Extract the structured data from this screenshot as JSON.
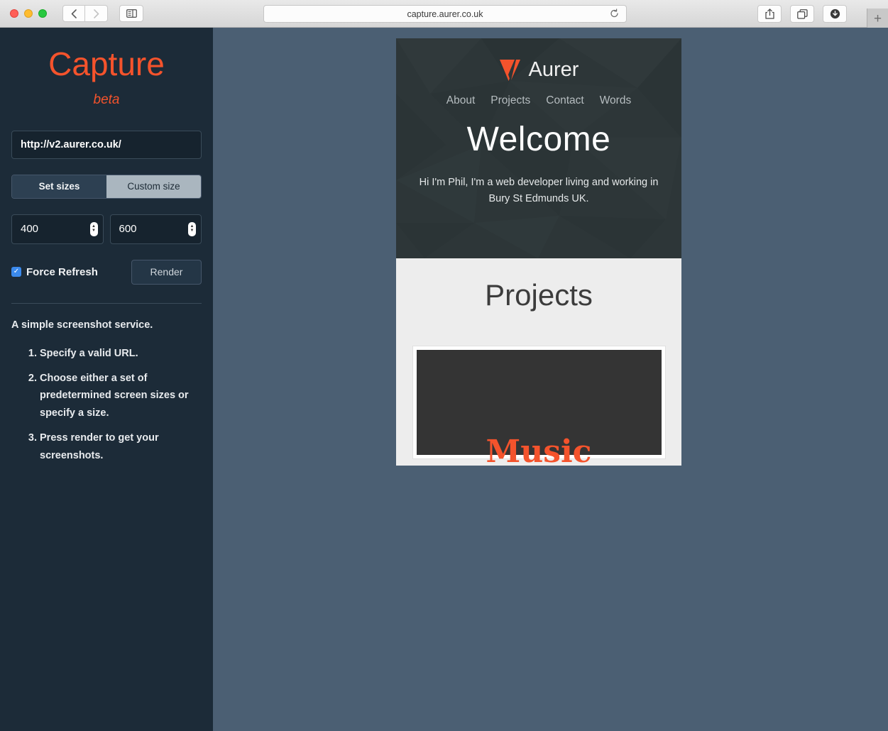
{
  "browser": {
    "url": "capture.aurer.co.uk",
    "reload_icon": "reload-icon",
    "back_icon": "chevron-left-icon",
    "forward_icon": "chevron-right-icon",
    "sidebar_icon": "sidebar-toggle-icon",
    "share_icon": "share-icon",
    "tabs_icon": "show-tabs-icon",
    "downloads_icon": "downloads-icon",
    "newtab_label": "+"
  },
  "sidebar": {
    "brand": "Capture",
    "beta": "beta",
    "url_value": "http://v2.aurer.co.uk/",
    "url_placeholder": "http://",
    "segments": [
      {
        "label": "Set sizes",
        "active": false
      },
      {
        "label": "Custom size",
        "active": true
      }
    ],
    "width_value": "400",
    "height_value": "600",
    "force_refresh_label": "Force Refresh",
    "force_refresh_checked": true,
    "check_glyph": "✓",
    "render_label": "Render",
    "blurb": "A simple screenshot service.",
    "steps": [
      "Specify a valid URL.",
      "Choose either a set of predetermined screen sizes or specify a size.",
      "Press render to get your screenshots."
    ],
    "accent_color": "#f4532c",
    "background_color": "#1c2b38"
  },
  "preview": {
    "site_name": "Aurer",
    "logo_icon": "aurer-triangle-logo",
    "nav": [
      "About",
      "Projects",
      "Contact",
      "Words"
    ],
    "headline": "Welcome",
    "intro": "Hi I'm Phil, I'm a web developer living and working in Bury St Edmunds UK.",
    "projects_title": "Projects",
    "project_cards": [
      {
        "label": "Music"
      }
    ],
    "hero_background": "#2d3638",
    "projects_background": "#ededed",
    "accent_color": "#f4532c"
  },
  "workspace": {
    "background_color": "#4b5f73"
  }
}
